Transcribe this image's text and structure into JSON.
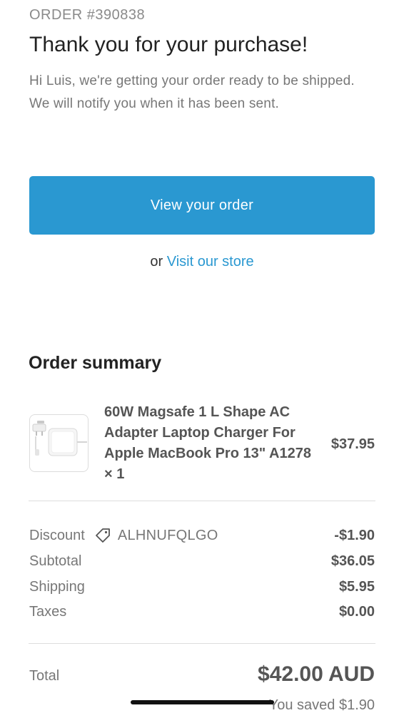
{
  "header": {
    "order_number": "ORDER #390838",
    "title": "Thank you for your purchase!",
    "message": "Hi Luis, we're getting your order ready to be shipped. We will notify you when it has been sent."
  },
  "actions": {
    "view_order_label": "View your order",
    "or_text": "or",
    "visit_store_label": "Visit our store",
    "accent_color": "#2a98d1"
  },
  "summary": {
    "title": "Order summary",
    "item": {
      "name": "60W Magsafe 1 L Shape AC Adapter Laptop Charger For Apple MacBook Pro 13\" A1278 × 1",
      "price": "$37.95",
      "image_icon": "charger-product-image"
    },
    "lines": [
      {
        "label": "Discount",
        "code": "ALHNUFQLGO",
        "value": "-$1.90",
        "icon": "tag-icon"
      },
      {
        "label": "Subtotal",
        "value": "$36.05"
      },
      {
        "label": "Shipping",
        "value": "$5.95"
      },
      {
        "label": "Taxes",
        "value": "$0.00"
      }
    ],
    "total": {
      "label": "Total",
      "value": "$42.00 AUD",
      "saved": "You saved $1.90"
    }
  }
}
